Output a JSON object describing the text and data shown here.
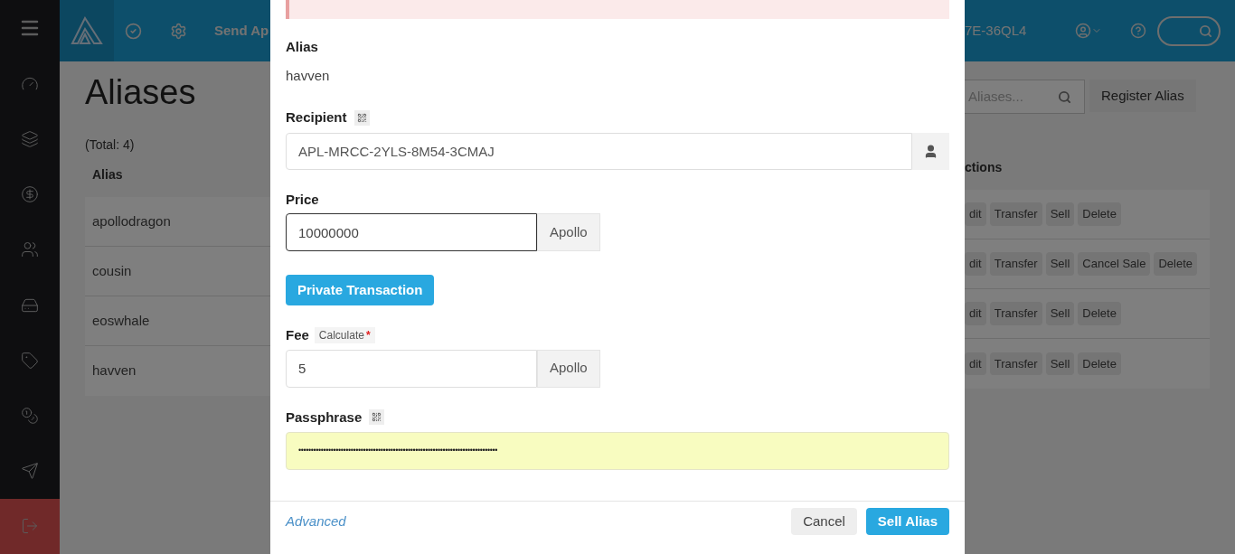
{
  "sidebar": {
    "items": [
      {
        "kind": "menu",
        "selected": false
      },
      {
        "kind": "dashboard",
        "selected": false
      },
      {
        "kind": "bars",
        "selected": false
      },
      {
        "kind": "coin",
        "selected": false
      },
      {
        "kind": "users",
        "selected": false
      },
      {
        "kind": "drive",
        "selected": false
      },
      {
        "kind": "tag",
        "selected": false
      },
      {
        "kind": "coins",
        "selected": false
      },
      {
        "kind": "mail",
        "selected": false
      },
      {
        "kind": "logout",
        "selected": true
      }
    ]
  },
  "header": {
    "left_link": "Send Ap",
    "account": "7E-36QL4"
  },
  "page": {
    "title": "Aliases",
    "total": "(Total: 4)",
    "column_1": "Alias",
    "column_2": "ctions",
    "search": {
      "placeholder": "Aliases..."
    },
    "register_button": "Register Alias",
    "rows": [
      {
        "alias": "apollodragon",
        "actions": [
          "dit",
          "Transfer",
          "Sell",
          "Delete"
        ]
      },
      {
        "alias": "cousin",
        "actions": [
          "dit",
          "Transfer",
          "Sell",
          "Cancel Sale",
          "Delete"
        ]
      },
      {
        "alias": "eoswhale",
        "actions": [
          "dit",
          "Transfer",
          "Sell",
          "Delete"
        ]
      },
      {
        "alias": "havven",
        "actions": [
          "dit",
          "Transfer",
          "Sell",
          "Delete"
        ]
      }
    ]
  },
  "modal": {
    "alias_label": "Alias",
    "alias_value": "havven",
    "recipient_label": "Recipient",
    "recipient_value": "APL-MRCC-2YLS-8M54-3CMAJ",
    "price_label": "Price",
    "price_value": "10000000",
    "price_unit": "Apollo",
    "private_button": "Private Transaction",
    "fee_label": "Fee",
    "calculate": "Calculate",
    "required": "*",
    "fee_value": "5",
    "fee_unit": "Apollo",
    "passphrase_label": "Passphrase",
    "passphrase_value": "••••••••••••••••••••••••••••••••••••••••••••••••••••••••••••••••••••••••••••••••",
    "advanced": "Advanced",
    "cancel": "Cancel",
    "submit": "Sell Alias"
  }
}
